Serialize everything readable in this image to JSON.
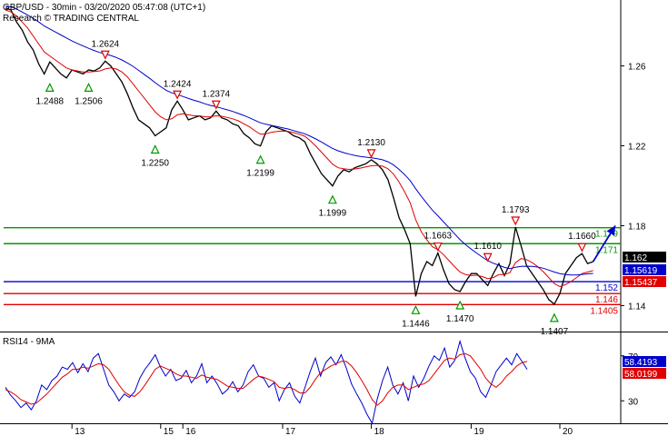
{
  "header": {
    "title": "GBP/USD - 30min - 03/20/2020 05:47:08 (UTC+1)",
    "source": "Research © TRADING CENTRAL"
  },
  "chart_data": [
    {
      "type": "line",
      "title": "GBP/USD - 30min - 03/20/2020 05:47:08 (UTC+1)",
      "subtitle": "Research © TRADING CENTRAL",
      "ylim": [
        1.127,
        1.293
      ],
      "y_ticks": [
        "1.26",
        "1.22",
        "1.18",
        "1.14"
      ],
      "y_tick_values": [
        1.26,
        1.22,
        1.18,
        1.14
      ],
      "x_tick_labels": [
        "13",
        "15",
        "16",
        "17",
        "18",
        "19",
        "20"
      ],
      "x_tick_index": [
        12,
        28,
        32,
        50,
        66,
        84,
        100
      ],
      "grid": false,
      "series": [
        {
          "role": "price",
          "color": "#000000",
          "values": [
            1.289,
            1.288,
            1.282,
            1.278,
            1.272,
            1.268,
            1.261,
            1.256,
            1.262,
            1.259,
            1.256,
            1.254,
            1.258,
            1.257,
            1.256,
            1.258,
            1.2575,
            1.259,
            1.2624,
            1.26,
            1.256,
            1.252,
            1.246,
            1.239,
            1.233,
            1.231,
            1.229,
            1.225,
            1.227,
            1.229,
            1.238,
            1.2424,
            1.238,
            1.233,
            1.234,
            1.235,
            1.233,
            1.234,
            1.2374,
            1.234,
            1.233,
            1.231,
            1.23,
            1.226,
            1.224,
            1.221,
            1.2199,
            1.227,
            1.23,
            1.229,
            1.228,
            1.227,
            1.225,
            1.224,
            1.222,
            1.216,
            1.211,
            1.206,
            1.203,
            1.1999,
            1.205,
            1.208,
            1.207,
            1.209,
            1.21,
            1.211,
            1.213,
            1.211,
            1.208,
            1.203,
            1.194,
            1.184,
            1.178,
            1.171,
            1.1446,
            1.156,
            1.162,
            1.16,
            1.1663,
            1.158,
            1.151,
            1.148,
            1.147,
            1.152,
            1.156,
            1.156,
            1.153,
            1.15,
            1.156,
            1.161,
            1.155,
            1.161,
            1.1793,
            1.17,
            1.16,
            1.156,
            1.152,
            1.148,
            1.143,
            1.1407,
            1.146,
            1.156,
            1.16,
            1.164,
            1.166,
            1.161,
            1.162
          ]
        },
        {
          "role": "moving-average-fast",
          "color": "#e00000",
          "values": [
            1.288,
            1.287,
            1.285,
            1.282,
            1.279,
            1.275,
            1.271,
            1.267,
            1.265,
            1.263,
            1.261,
            1.259,
            1.258,
            1.2575,
            1.257,
            1.257,
            1.2572,
            1.2575,
            1.2585,
            1.259,
            1.2585,
            1.257,
            1.2545,
            1.251,
            1.2475,
            1.244,
            1.2405,
            1.237,
            1.2345,
            1.233,
            1.2335,
            1.2355,
            1.236,
            1.2355,
            1.235,
            1.235,
            1.2345,
            1.2345,
            1.235,
            1.2348,
            1.2342,
            1.2335,
            1.2325,
            1.231,
            1.2295,
            1.2275,
            1.2258,
            1.226,
            1.2268,
            1.2272,
            1.2274,
            1.2272,
            1.2266,
            1.2258,
            1.2248,
            1.2225,
            1.2198,
            1.2168,
            1.2138,
            1.2108,
            1.209,
            1.2085,
            1.2082,
            1.2084,
            1.2088,
            1.2094,
            1.21,
            1.2102,
            1.2098,
            1.2085,
            1.2058,
            1.2018,
            1.197,
            1.1915,
            1.183,
            1.177,
            1.173,
            1.1695,
            1.168,
            1.1655,
            1.1625,
            1.1595,
            1.1568,
            1.1555,
            1.155,
            1.1552,
            1.1545,
            1.1535,
            1.154,
            1.1555,
            1.1555,
            1.1565,
            1.1615,
            1.1635,
            1.163,
            1.1615,
            1.1595,
            1.157,
            1.154,
            1.151,
            1.1495,
            1.1505,
            1.152,
            1.154,
            1.156,
            1.1568,
            1.1575
          ]
        },
        {
          "role": "moving-average-slow",
          "color": "#0000cc",
          "values": [
            1.29,
            1.2895,
            1.2885,
            1.287,
            1.2855,
            1.2838,
            1.282,
            1.28,
            1.2785,
            1.277,
            1.2755,
            1.274,
            1.2725,
            1.2712,
            1.27,
            1.2688,
            1.2677,
            1.2667,
            1.266,
            1.2652,
            1.2642,
            1.263,
            1.2615,
            1.2598,
            1.2578,
            1.2558,
            1.2538,
            1.2516,
            1.2496,
            1.2478,
            1.2465,
            1.2456,
            1.2447,
            1.2437,
            1.2428,
            1.242,
            1.241,
            1.2402,
            1.2396,
            1.2388,
            1.238,
            1.2372,
            1.2362,
            1.2352,
            1.234,
            1.2328,
            1.2315,
            1.2308,
            1.2302,
            1.2296,
            1.229,
            1.2284,
            1.2276,
            1.2268,
            1.226,
            1.2248,
            1.2234,
            1.2219,
            1.2203,
            1.2187,
            1.2175,
            1.2166,
            1.2158,
            1.2152,
            1.2147,
            1.2143,
            1.214,
            1.2136,
            1.213,
            1.212,
            1.2104,
            1.2082,
            1.2056,
            1.2026,
            1.1985,
            1.1947,
            1.1912,
            1.1878,
            1.185,
            1.182,
            1.179,
            1.176,
            1.173,
            1.1705,
            1.1683,
            1.1663,
            1.1643,
            1.1625,
            1.1612,
            1.1602,
            1.1591,
            1.1585,
            1.1592,
            1.1596,
            1.1597,
            1.1596,
            1.1593,
            1.1587,
            1.1578,
            1.1568,
            1.156,
            1.1555,
            1.1553,
            1.1553,
            1.1556,
            1.1559,
            1.1561
          ]
        }
      ],
      "markers": [
        {
          "label": "1.2488",
          "index": 8,
          "value": 1.256,
          "kind": "support"
        },
        {
          "label": "1.2506",
          "index": 15,
          "value": 1.256,
          "kind": "support"
        },
        {
          "label": "1.2624",
          "index": 18,
          "value": 1.2624,
          "kind": "resistance"
        },
        {
          "label": "1.2250",
          "index": 27,
          "value": 1.225,
          "kind": "support"
        },
        {
          "label": "1.2424",
          "index": 31,
          "value": 1.2424,
          "kind": "resistance"
        },
        {
          "label": "1.2374",
          "index": 38,
          "value": 1.2374,
          "kind": "resistance"
        },
        {
          "label": "1.2199",
          "index": 46,
          "value": 1.2199,
          "kind": "support"
        },
        {
          "label": "1.1999",
          "index": 59,
          "value": 1.1999,
          "kind": "support"
        },
        {
          "label": "1.2130",
          "index": 66,
          "value": 1.213,
          "kind": "resistance"
        },
        {
          "label": "1.1446",
          "index": 74,
          "value": 1.1446,
          "kind": "support"
        },
        {
          "label": "1.1663",
          "index": 78,
          "value": 1.1663,
          "kind": "resistance"
        },
        {
          "label": "1.1470",
          "index": 82,
          "value": 1.147,
          "kind": "support"
        },
        {
          "label": "1.1610",
          "index": 87,
          "value": 1.161,
          "kind": "resistance"
        },
        {
          "label": "1.1793",
          "index": 92,
          "value": 1.1793,
          "kind": "resistance"
        },
        {
          "label": "1.1407",
          "index": 99,
          "value": 1.1407,
          "kind": "support"
        },
        {
          "label": "1.1660",
          "index": 104,
          "value": 1.166,
          "kind": "resistance"
        }
      ],
      "horizontal_levels": [
        {
          "label": "1.179",
          "value": 1.179,
          "color": "#009900"
        },
        {
          "label": "1.171",
          "value": 1.171,
          "color": "#009900"
        },
        {
          "label": "1.152",
          "value": 1.152,
          "color": "#0000cc"
        },
        {
          "label": "1.146",
          "value": 1.146,
          "color": "#e00000"
        },
        {
          "label": "1.1405",
          "value": 1.1405,
          "color": "#e00000"
        }
      ],
      "right_badges": [
        {
          "label": "1.162",
          "value": 1.162,
          "bg": "#000000",
          "fg": "#ffffff"
        },
        {
          "label": "1.15619",
          "value": 1.15619,
          "bg": "#0000cc",
          "fg": "#ffffff"
        },
        {
          "label": "1.15437",
          "value": 1.15437,
          "bg": "#e00000",
          "fg": "#ffffff"
        }
      ],
      "forecast_arrow": {
        "from_index": 106,
        "from_value": 1.162,
        "to_index": 110,
        "to_value": 1.18,
        "color": "#0000cc"
      }
    },
    {
      "type": "line",
      "title": "RSI14 - 9MA",
      "ylim": [
        10,
        90
      ],
      "y_ticks": [
        "70",
        "30"
      ],
      "y_tick_values": [
        70,
        30
      ],
      "series": [
        {
          "role": "rsi",
          "color": "#0000cc",
          "values": [
            42,
            35,
            30,
            24,
            28,
            22,
            30,
            44,
            40,
            48,
            52,
            60,
            58,
            64,
            55,
            63,
            56,
            68,
            72,
            58,
            44,
            38,
            30,
            36,
            33,
            38,
            50,
            58,
            64,
            71,
            60,
            52,
            58,
            48,
            50,
            57,
            46,
            52,
            63,
            46,
            52,
            45,
            36,
            40,
            47,
            38,
            44,
            56,
            62,
            52,
            50,
            42,
            46,
            30,
            40,
            46,
            34,
            28,
            42,
            56,
            68,
            52,
            64,
            69,
            62,
            71,
            59,
            45,
            36,
            28,
            18,
            10,
            32,
            48,
            60,
            44,
            36,
            46,
            30,
            52,
            42,
            50,
            61,
            70,
            66,
            77,
            60,
            66,
            83,
            68,
            56,
            50,
            38,
            33,
            44,
            56,
            62,
            68,
            62,
            72,
            65,
            58
          ]
        },
        {
          "role": "ma",
          "color": "#e00000",
          "values": [
            40,
            38,
            35,
            31,
            29,
            27,
            28,
            32,
            36,
            41,
            46,
            51,
            54,
            58,
            58,
            60,
            59,
            61,
            63,
            62,
            58,
            51,
            44,
            38,
            35,
            34,
            38,
            44,
            51,
            58,
            61,
            59,
            57,
            54,
            52,
            52,
            51,
            50,
            53,
            51,
            50,
            49,
            46,
            43,
            42,
            41,
            41,
            45,
            49,
            52,
            51,
            49,
            47,
            42,
            41,
            42,
            40,
            37,
            37,
            42,
            49,
            55,
            58,
            61,
            63,
            65,
            65,
            61,
            55,
            48,
            40,
            31,
            26,
            30,
            37,
            42,
            44,
            44,
            40,
            42,
            44,
            45,
            48,
            54,
            60,
            66,
            68,
            67,
            71,
            72,
            70,
            64,
            58,
            50,
            45,
            42,
            46,
            52,
            56,
            61,
            64,
            65
          ]
        }
      ],
      "badges": [
        {
          "label": "58.4193",
          "value": 58.4193,
          "bg": "#0000cc",
          "fg": "#ffffff"
        },
        {
          "label": "58.0199",
          "value": 58.0199,
          "bg": "#e00000",
          "fg": "#ffffff"
        }
      ]
    }
  ]
}
